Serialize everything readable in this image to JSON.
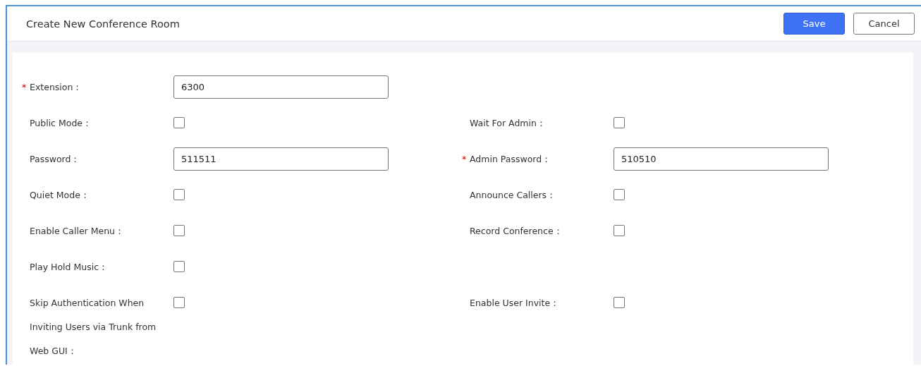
{
  "header": {
    "title": "Create New Conference Room",
    "buttons": [
      {
        "label": "Save",
        "kind": "primary"
      },
      {
        "label": "Cancel",
        "kind": "secondary"
      }
    ]
  },
  "rows": [
    {
      "left": {
        "kind": "text",
        "marker": "*",
        "label": "Extension：",
        "value": "6300"
      },
      "right": null
    },
    {
      "left": {
        "kind": "checkbox",
        "label": "Public Mode：",
        "checked": false
      },
      "right": {
        "kind": "checkbox",
        "label": "Wait For Admin：",
        "checked": false
      }
    },
    {
      "left": {
        "kind": "text",
        "label": "Password：",
        "value": "511511"
      },
      "right": {
        "kind": "text",
        "marker": "*",
        "label": "Admin Password：",
        "value": "510510"
      }
    },
    {
      "left": {
        "kind": "checkbox",
        "label": "Quiet Mode：",
        "checked": false
      },
      "right": {
        "kind": "checkbox",
        "label": "Announce Callers：",
        "checked": false
      }
    },
    {
      "left": {
        "kind": "checkbox",
        "label": "Enable Caller Menu：",
        "checked": false
      },
      "right": {
        "kind": "checkbox",
        "label": "Record Conference：",
        "checked": false
      }
    },
    {
      "left": {
        "kind": "checkbox",
        "label": "Play Hold Music：",
        "checked": false
      },
      "right": null
    },
    {
      "left": {
        "kind": "checkbox",
        "label": "Skip Authentication When Inviting Users via Trunk from Web GUI：",
        "checked": false
      },
      "right": {
        "kind": "checkbox",
        "label": "Enable User Invite：",
        "checked": false
      }
    }
  ]
}
